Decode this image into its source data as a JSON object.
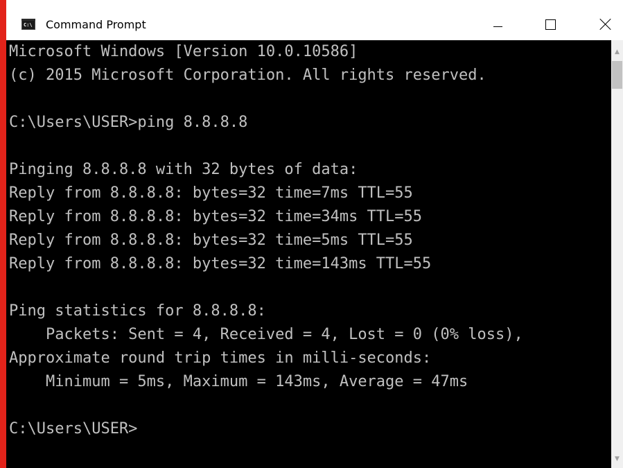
{
  "window": {
    "title": "Command Prompt",
    "icon": "cmd-icon",
    "icon_text": "C:\\",
    "controls": {
      "minimize": "minimize-icon",
      "maximize": "maximize-icon",
      "close": "close-icon"
    }
  },
  "console": {
    "lines": [
      "Microsoft Windows [Version 10.0.10586]",
      "(c) 2015 Microsoft Corporation. All rights reserved.",
      "",
      "C:\\Users\\USER>ping 8.8.8.8",
      "",
      "Pinging 8.8.8.8 with 32 bytes of data:",
      "Reply from 8.8.8.8: bytes=32 time=7ms TTL=55",
      "Reply from 8.8.8.8: bytes=32 time=34ms TTL=55",
      "Reply from 8.8.8.8: bytes=32 time=5ms TTL=55",
      "Reply from 8.8.8.8: bytes=32 time=143ms TTL=55",
      "",
      "Ping statistics for 8.8.8.8:",
      "    Packets: Sent = 4, Received = 4, Lost = 0 (0% loss),",
      "Approximate round trip times in milli-seconds:",
      "    Minimum = 5ms, Maximum = 143ms, Average = 47ms",
      "",
      "C:\\Users\\USER>"
    ]
  },
  "colors": {
    "console_bg": "#000000",
    "console_text": "#c0c0c0",
    "titlebar_bg": "#ffffff",
    "accent_edge": "#e2231a"
  }
}
